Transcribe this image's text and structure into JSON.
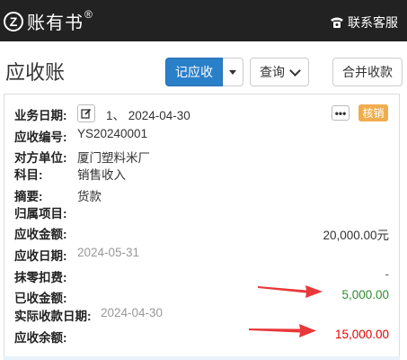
{
  "app": {
    "name": "账有书",
    "reg": "®",
    "logo_letter": "Z"
  },
  "header": {
    "contact_label": "联系客服"
  },
  "page": {
    "title": "应收账"
  },
  "toolbar": {
    "record_label": "记应收",
    "query_label": "查询",
    "merge_label": "合并收款"
  },
  "record": {
    "date_label": "业务日期:",
    "date_value": "1、 2024-04-30",
    "code_label": "应收编号:",
    "code_value": "YS20240001",
    "party_label": "对方单位:",
    "party_value": "厦门塑料米厂",
    "subject_label": "科目:",
    "subject_value": "销售收入",
    "summary_label": "摘要:",
    "summary_value": "货款",
    "project_label": "归属项目:",
    "project_value": "",
    "amount_label": "应收金额:",
    "amount_value": "20,000.00元",
    "due_label": "应收日期:",
    "due_value": "2024-05-31",
    "discount_label": "抹零扣费:",
    "discount_value": "-",
    "received_label": "已收金额:",
    "received_value": "5,000.00",
    "actual_date_label": "实际收款日期:",
    "actual_date_value": "2024-04-30",
    "balance_label": "应收余额:",
    "balance_value": "15,000.00",
    "more_label": "•••",
    "writeoff_label": "核销"
  },
  "colors": {
    "received": "#2e8b2e",
    "balance": "#e00000",
    "arrow": "#e8383a",
    "primary": "#2a7fc9",
    "badge": "#f0ad4e"
  },
  "icons": [
    "logo-icon",
    "phone-icon",
    "edit-icon",
    "caret-down-icon",
    "chevron-down-icon",
    "more-icon",
    "arrow-icon"
  ]
}
